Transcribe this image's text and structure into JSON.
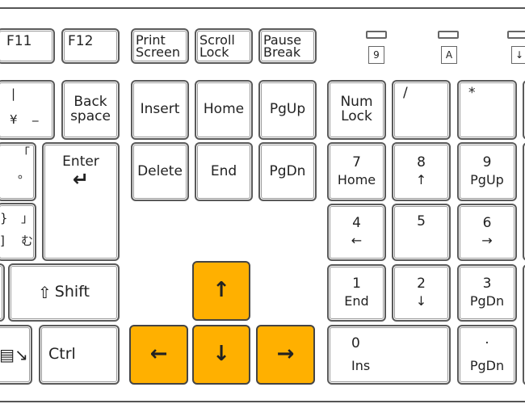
{
  "function_row": {
    "f11": "F11",
    "f12": "F12",
    "print_screen": [
      "Print",
      "Screen"
    ],
    "scroll_lock": [
      "Scroll",
      "Lock"
    ],
    "pause_break": [
      "Pause",
      "Break"
    ]
  },
  "indicators": [
    {
      "label": "9"
    },
    {
      "label": "A"
    },
    {
      "label": "↓"
    }
  ],
  "main": {
    "yen_key": {
      "top": "|",
      "left": "¥",
      "right": "_"
    },
    "backspace": [
      "Back",
      "space"
    ],
    "bracket_open_key": {
      "top": "「",
      "bottom": "。"
    },
    "bracket_close_key": {
      "tl": "}",
      "tr": "」",
      "bl": "]",
      "br": "む"
    },
    "enter": "Enter",
    "enter_arrow": "↵",
    "shift": "Shift",
    "shift_icon": "⇧",
    "ctrl": "Ctrl",
    "menu_icon": "menu-key-icon"
  },
  "nav": {
    "insert": "Insert",
    "home": "Home",
    "pgup": "PgUp",
    "delete": "Delete",
    "end": "End",
    "pgdn": "PgDn"
  },
  "arrows": {
    "up": "↑",
    "left": "←",
    "down": "↓",
    "right": "→",
    "highlight_color": "#ffb000"
  },
  "numpad": {
    "numlock": [
      "Num",
      "Lock"
    ],
    "divide": "/",
    "multiply": "*",
    "k7": [
      "7",
      "Home"
    ],
    "k8": [
      "8",
      "↑"
    ],
    "k9": [
      "9",
      "PgUp"
    ],
    "k4": [
      "4",
      "←"
    ],
    "k5": "5",
    "k6": [
      "6",
      "→"
    ],
    "k1": [
      "1",
      "End"
    ],
    "k2": [
      "2",
      "↓"
    ],
    "k3": [
      "3",
      "PgDn"
    ],
    "k0": [
      "0",
      "Ins"
    ],
    "dot": [
      "·",
      "PgDn"
    ]
  }
}
